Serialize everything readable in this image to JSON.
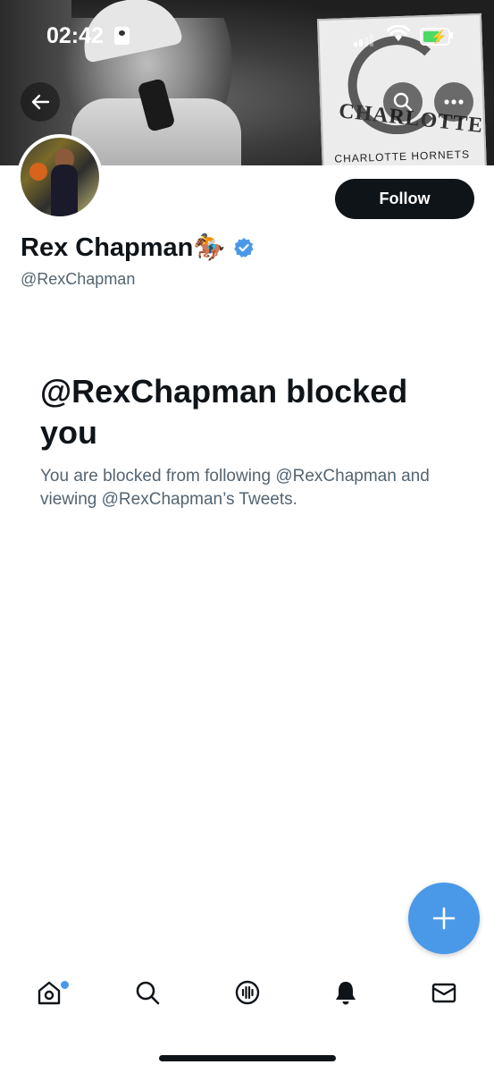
{
  "status_bar": {
    "time": "02:42"
  },
  "banner": {
    "sign_text": "CHARLOTTE",
    "sign_subtext": "CHARLOTTE HORNETS"
  },
  "profile": {
    "name": "Rex Chapman🏇",
    "handle": "@RexChapman",
    "verified": true,
    "follow_label": "Follow"
  },
  "blocked": {
    "title": "@RexChapman blocked you",
    "description": "You are blocked from following @RexChapman and viewing @RexChapman’s Tweets."
  },
  "colors": {
    "accent": "#4a99e9",
    "text_primary": "#0f1419",
    "text_secondary": "#536471"
  },
  "nav": {
    "tabs": [
      "home-icon",
      "search-icon",
      "spaces-icon",
      "notifications-icon",
      "messages-icon"
    ]
  }
}
